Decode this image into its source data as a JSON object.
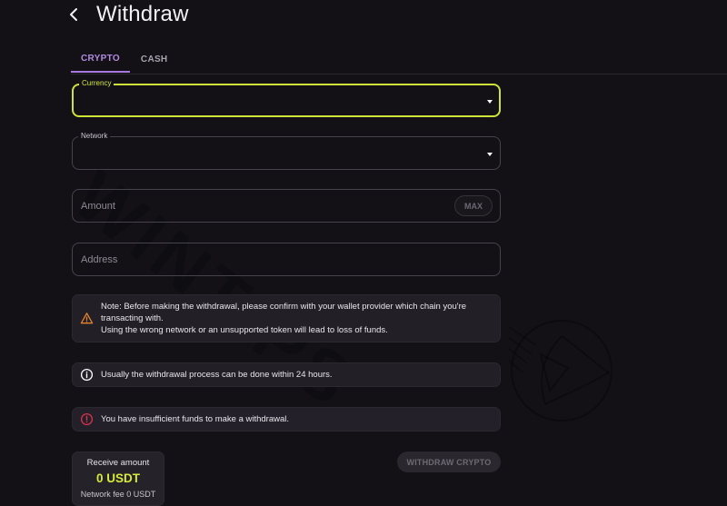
{
  "header": {
    "back_icon": "chevron-left-icon",
    "title": "Withdraw"
  },
  "tabs": [
    {
      "label": "CRYPTO",
      "active": true
    },
    {
      "label": "CASH",
      "active": false
    }
  ],
  "form": {
    "currency": {
      "label": "Currency",
      "value": "",
      "icon": "caret-down-icon"
    },
    "network": {
      "label": "Network",
      "value": "",
      "icon": "caret-down-icon"
    },
    "amount": {
      "placeholder": "Amount",
      "value": "",
      "max_label": "MAX"
    },
    "address": {
      "placeholder": "Address",
      "value": ""
    }
  },
  "alerts": {
    "note": {
      "icon": "warning-icon",
      "lines": [
        "Note: Before making the withdrawal, please confirm with your wallet provider which chain you're",
        "transacting with.",
        "Using the wrong network or an unsupported token will lead to loss of funds."
      ]
    },
    "info": {
      "icon": "info-icon",
      "text": "Usually the withdrawal process can be done within 24 hours."
    },
    "error": {
      "icon": "error-icon",
      "text": "You have insufficient funds to make a withdrawal."
    }
  },
  "receive": {
    "label": "Receive amount",
    "value": "0 USDT",
    "fee": "Network fee 0 USDT"
  },
  "actions": {
    "withdraw_label": "WITHDRAW CRYPTO",
    "withdraw_disabled": true
  },
  "watermark": {
    "text": "WINTIPS"
  },
  "colors": {
    "background": "#131116",
    "accent_focus": "#cfe23a",
    "tab_active": "#a779e0",
    "warning": "#e0822e",
    "error": "#d6334e",
    "receive_value": "#d6ea3a"
  }
}
